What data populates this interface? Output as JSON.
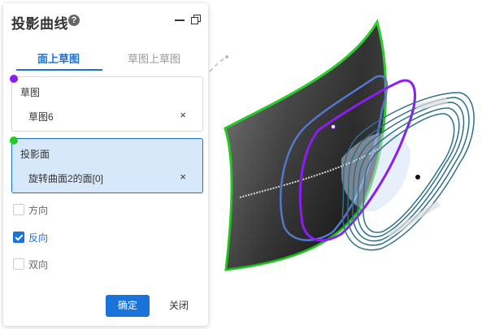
{
  "panel": {
    "title": "投影曲线",
    "help_icon": "?",
    "tabs": [
      {
        "label": "面上草图",
        "active": true
      },
      {
        "label": "草图上草图",
        "active": false
      }
    ],
    "sketch_section": {
      "label": "草图",
      "value": "草图6",
      "close": "×",
      "marker_color": "#8a1ef0"
    },
    "projection_section": {
      "label": "投影面",
      "value": "旋转曲面2的面[0]",
      "close": "×",
      "marker_color": "#22cc22"
    },
    "options": [
      {
        "label": "方向",
        "checked": false
      },
      {
        "label": "反向",
        "checked": true
      },
      {
        "label": "双向",
        "checked": false
      }
    ],
    "ok_label": "确定",
    "close_label": "关闭"
  },
  "colors": {
    "accent": "#1a73d9",
    "surface_outline": "#22cc22",
    "sketch_curve": "#8a1ef0",
    "projected_curve": "#5577cc",
    "teal_curve": "#2e6f8a"
  }
}
